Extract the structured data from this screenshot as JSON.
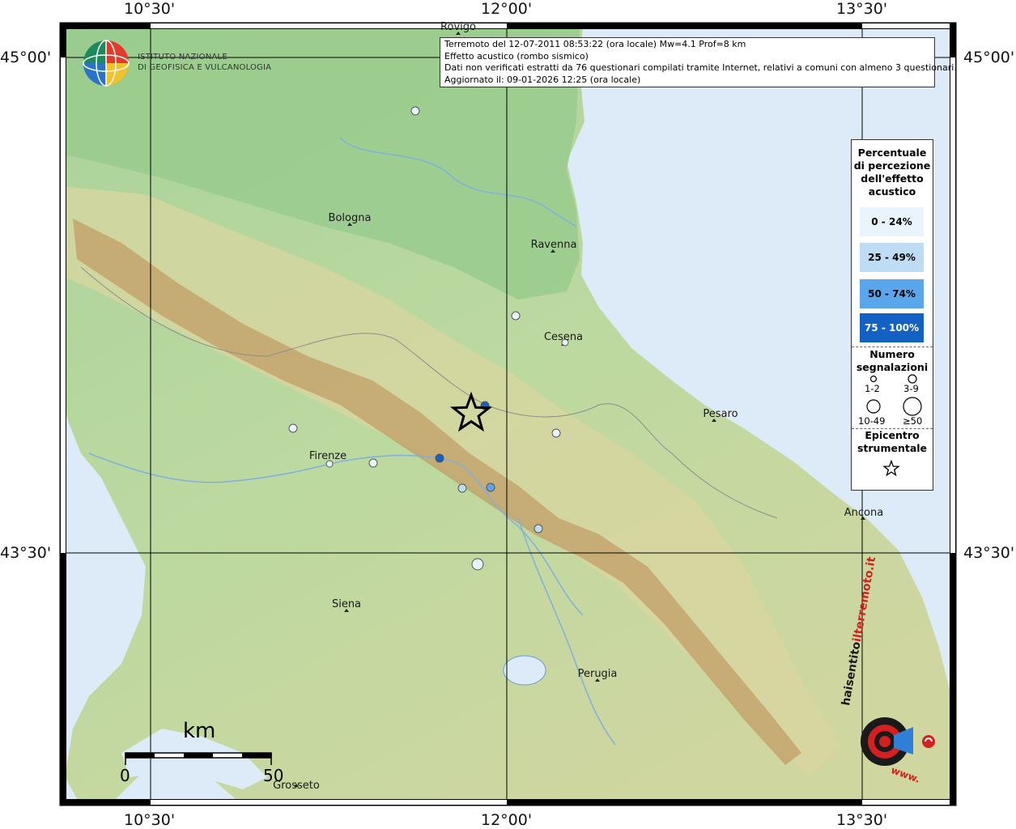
{
  "axes": {
    "top_ticks": [
      "10°30'",
      "12°00'",
      "13°30'"
    ],
    "bottom_ticks": [
      "10°30'",
      "12°00'",
      "13°30'"
    ],
    "left_ticks": [
      "45°00'",
      "43°30'"
    ],
    "right_ticks": [
      "45°00'",
      "43°30'"
    ]
  },
  "info": {
    "line1": "Terremoto del 12-07-2011 08:53:22 (ora locale) Mw=4.1 Prof=8 km",
    "line2": "Effetto acustico (rombo sismico)",
    "line3": "Dati non verificati estratti da 76 questionari compilati tramite Internet, relativi a comuni con almeno 3 questionari.",
    "line4": "Aggiornato il: 09-01-2026 12:25 (ora locale)"
  },
  "logo": {
    "line1": "ISTITUTO NAZIONALE",
    "line2": "DI GEOFISICA E VULCANOLOGIA"
  },
  "cities": [
    {
      "id": "rovigo",
      "name": "Rovigo"
    },
    {
      "id": "bologna",
      "name": "Bologna"
    },
    {
      "id": "ravenna",
      "name": "Ravenna"
    },
    {
      "id": "cesena",
      "name": "Cesena"
    },
    {
      "id": "pesaro",
      "name": "Pesaro"
    },
    {
      "id": "firenze",
      "name": "Firenze"
    },
    {
      "id": "ancona",
      "name": "Ancona"
    },
    {
      "id": "siena",
      "name": "Siena"
    },
    {
      "id": "perugia",
      "name": "Perugia"
    },
    {
      "id": "grosseto",
      "name": "Grosseto"
    }
  ],
  "legend": {
    "title": [
      "Percentuale",
      "di percezione",
      "dell'effetto",
      "acustico"
    ],
    "classes": [
      {
        "label": "0 - 24%",
        "color": "#eaf4fc"
      },
      {
        "label": "25 - 49%",
        "color": "#bfdcf5"
      },
      {
        "label": "50 - 74%",
        "color": "#5aa6ec"
      },
      {
        "label": "75 - 100%",
        "color": "#1461c4"
      }
    ],
    "count_title": [
      "Numero",
      "segnalazioni"
    ],
    "count_sizes": [
      "1-2",
      "3-9",
      "10-49",
      "≥50"
    ],
    "epicenter_title": [
      "Epicentro",
      "strumentale"
    ]
  },
  "scale": {
    "unit": "km",
    "start": "0",
    "end": "50"
  },
  "watermark": {
    "text_left": "haisentito",
    "text_mid": "ilterremoto",
    "text_right": ".it",
    "text_bottom": "www."
  },
  "colors": {
    "sea": "#dcebf7",
    "lowland": "#9fcf95",
    "hills": "#d9d8a0",
    "mountains": "#b58a52"
  }
}
